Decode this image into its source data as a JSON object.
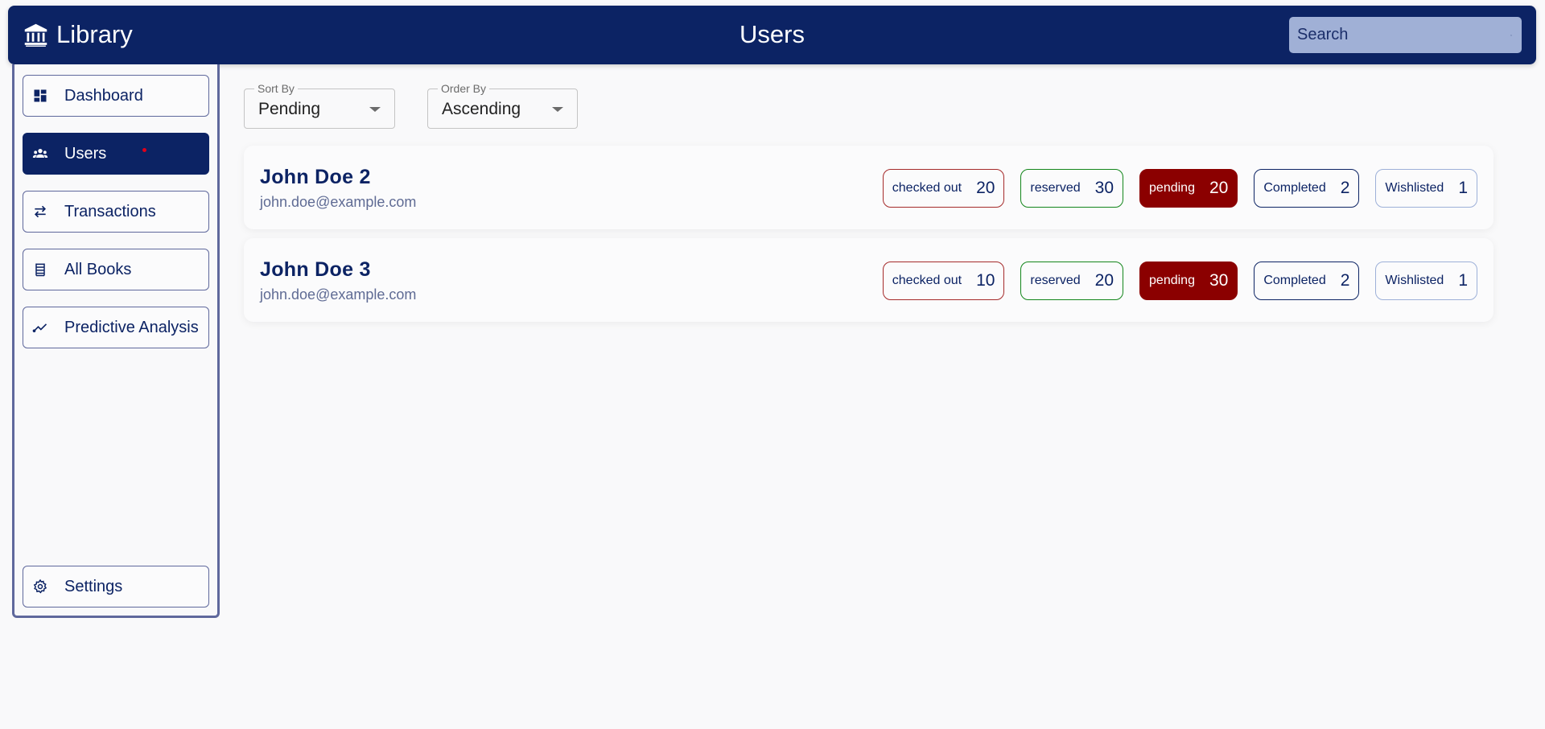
{
  "header": {
    "brand": "Library",
    "brand_icon": "bank-icon",
    "title": "Users",
    "search_placeholder": "Search",
    "search_value": ""
  },
  "sidebar": {
    "items": [
      {
        "label": "Dashboard",
        "icon": "dashboard-icon",
        "active": false
      },
      {
        "label": "Users",
        "icon": "users-icon",
        "active": true,
        "notification": true
      },
      {
        "label": "Transactions",
        "icon": "swap-arrows-icon",
        "active": false
      },
      {
        "label": "All Books",
        "icon": "books-icon",
        "active": false
      },
      {
        "label": "Predictive Analysis",
        "icon": "trend-line-icon",
        "active": false
      }
    ],
    "settings": {
      "label": "Settings",
      "icon": "gear-icon"
    }
  },
  "filters": {
    "sort_by": {
      "label": "Sort By",
      "value": "Pending"
    },
    "order_by": {
      "label": "Order By",
      "value": "Ascending"
    }
  },
  "users": [
    {
      "name": "John Doe 2",
      "email": "john.doe@example.com",
      "stats": [
        {
          "label": "checked out",
          "count": "20"
        },
        {
          "label": "reserved",
          "count": "30"
        },
        {
          "label": "pending",
          "count": "20"
        },
        {
          "label": "Completed",
          "count": "2"
        },
        {
          "label": "Wishlisted",
          "count": "1"
        }
      ]
    },
    {
      "name": "John Doe 3",
      "email": "john.doe@example.com",
      "stats": [
        {
          "label": "checked out",
          "count": "10"
        },
        {
          "label": "reserved",
          "count": "20"
        },
        {
          "label": "pending",
          "count": "30"
        },
        {
          "label": "Completed",
          "count": "2"
        },
        {
          "label": "Wishlisted",
          "count": "1"
        }
      ]
    }
  ],
  "colors": {
    "primary": "#0c2364",
    "checked_out": "#a52a2a",
    "reserved": "#13861b",
    "pending": "#8b0000",
    "wishlisted": "#9db0d8",
    "search_bg": "#a0b0d6",
    "notification": "#e0001a"
  }
}
